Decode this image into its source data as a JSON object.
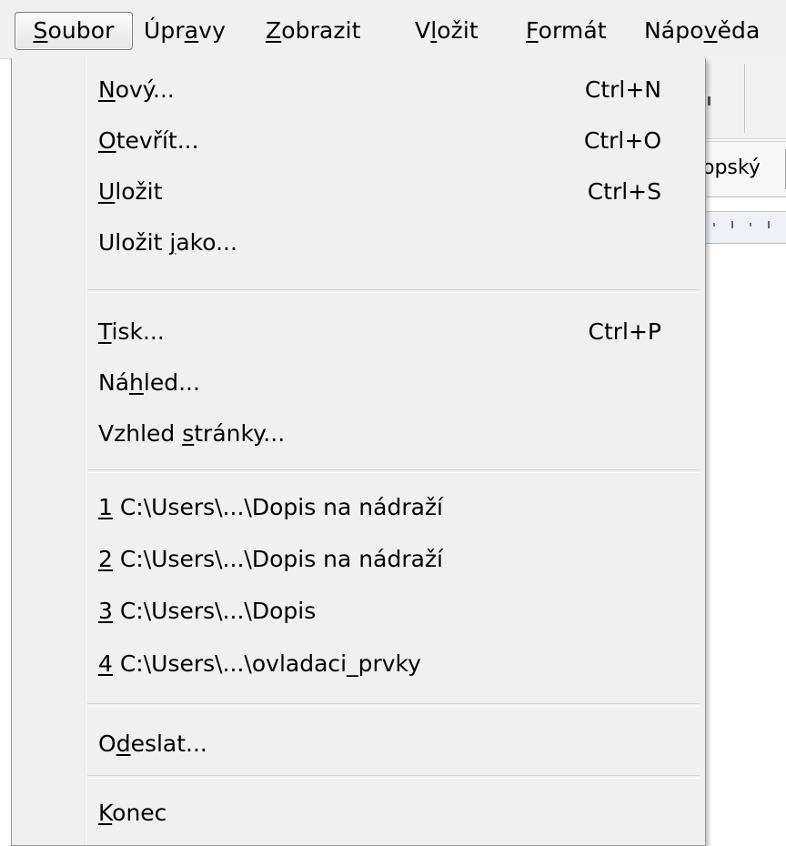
{
  "menubar": {
    "items": [
      {
        "pre": "",
        "u": "S",
        "post": "oubor"
      },
      {
        "pre": "Úpr",
        "u": "a",
        "post": "vy"
      },
      {
        "pre": "",
        "u": "Z",
        "post": "obrazit"
      },
      {
        "pre": "V",
        "u": "l",
        "post": "ožit"
      },
      {
        "pre": "",
        "u": "F",
        "post": "ormát"
      },
      {
        "pre": "Nápo",
        "u": "v",
        "post": "ěda"
      }
    ]
  },
  "background": {
    "font_name_partial": "opský"
  },
  "file_menu": {
    "items": [
      {
        "pre": "",
        "u": "N",
        "post": "ový...",
        "shortcut": "Ctrl+N"
      },
      {
        "pre": "",
        "u": "O",
        "post": "tevřít...",
        "shortcut": "Ctrl+O"
      },
      {
        "pre": "",
        "u": "U",
        "post": "ložit",
        "shortcut": "Ctrl+S"
      },
      {
        "pre": "Uložit ",
        "u": "j",
        "post": "ako...",
        "shortcut": ""
      },
      {
        "pre": "",
        "u": "T",
        "post": "isk...",
        "shortcut": "Ctrl+P"
      },
      {
        "pre": "Ná",
        "u": "h",
        "post": "led...",
        "shortcut": ""
      },
      {
        "pre": "Vzhled ",
        "u": "s",
        "post": "tránky...",
        "shortcut": ""
      },
      {
        "pre": "",
        "u": "1",
        "post": " C:\\Users\\...\\Dopis na nádraží",
        "shortcut": ""
      },
      {
        "pre": "",
        "u": "2",
        "post": " C:\\Users\\...\\Dopis na nádraží",
        "shortcut": ""
      },
      {
        "pre": "",
        "u": "3",
        "post": " C:\\Users\\...\\Dopis",
        "shortcut": ""
      },
      {
        "pre": "",
        "u": "4",
        "post": " C:\\Users\\...\\ovladaci_prvky",
        "shortcut": ""
      },
      {
        "pre": "O",
        "u": "d",
        "post": "eslat...",
        "shortcut": ""
      },
      {
        "pre": "",
        "u": "K",
        "post": "onec",
        "shortcut": ""
      }
    ]
  }
}
